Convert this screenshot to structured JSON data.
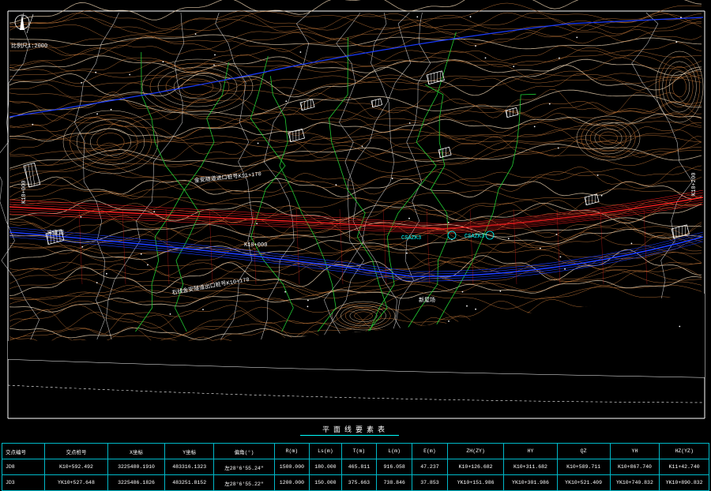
{
  "drawing": {
    "scale_label": "比例尺1:2000",
    "colors": {
      "background": "#000000",
      "contour": "#c87a3a",
      "contour_index": "#e2c9a8",
      "road_red": "#ff2020",
      "road_blue": "#1a3cff",
      "stream_green": "#22cc33",
      "table_grid": "#00b8c8",
      "frame": "#ffffff"
    },
    "labels": {
      "station_left": "CSAZK3",
      "station_right": "CSAZK3",
      "tunnel_label_1": "金安隧道进口桩号K11+170",
      "tunnel_label_2": "右线金安隧道出口桩号K10+170",
      "road_label": "K10+000",
      "area_label_1": "宋家湾",
      "area_label_2": "新屋场",
      "side_label_left": "K10+000",
      "side_label_right": "K10+200"
    }
  },
  "table": {
    "title": "平面线要素表",
    "headers": [
      "交点编号",
      "交点桩号",
      "X坐标",
      "Y坐标",
      "偏角(°)",
      "R(m)",
      "Ls(m)",
      "T(m)",
      "L(m)",
      "E(m)",
      "ZH(ZY)",
      "HY",
      "QZ",
      "YH",
      "HZ(YZ)"
    ],
    "rows": [
      [
        "JD8",
        "K10+592.492",
        "3225480.1910",
        "483316.1323",
        "左28°6'55.24\"",
        "1500.000",
        "180.000",
        "465.811",
        "916.058",
        "47.237",
        "K10+126.682",
        "K10+311.682",
        "K10+589.711",
        "K10+867.740",
        "K11+42.740"
      ],
      [
        "JD3",
        "YK10+527.648",
        "3225486.1826",
        "483251.8152",
        "左28°6'55.22\"",
        "1200.000",
        "150.000",
        "375.663",
        "738.846",
        "37.853",
        "YK10+151.986",
        "YK10+301.986",
        "YK10+521.409",
        "YK10+740.832",
        "YK10+890.832"
      ]
    ]
  }
}
